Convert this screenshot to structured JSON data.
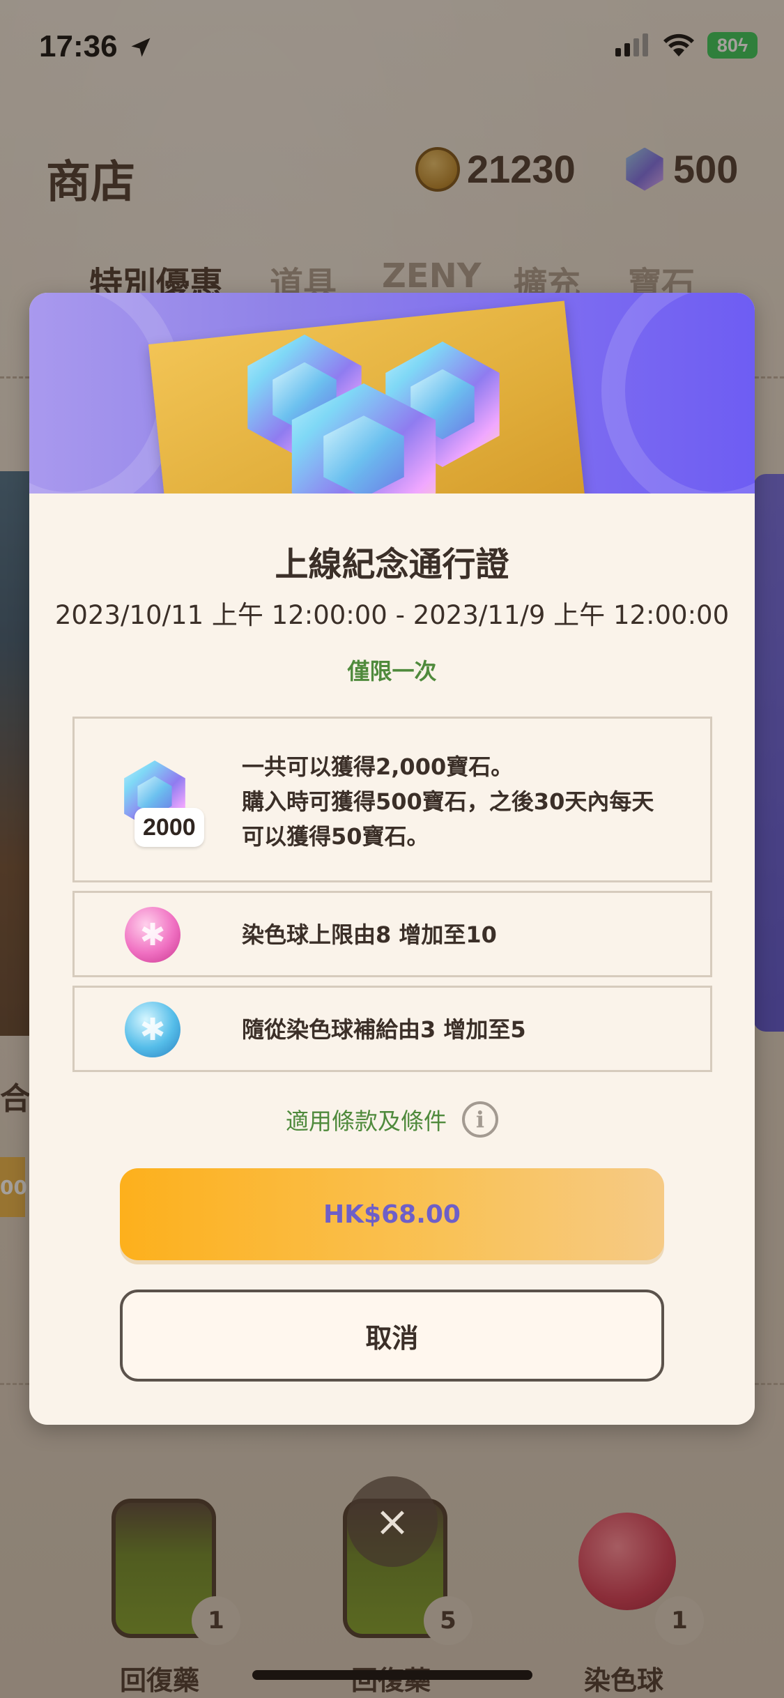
{
  "status_bar": {
    "time": "17:36",
    "battery": "80"
  },
  "shop": {
    "title": "商店",
    "coins": "21230",
    "gems": "500",
    "tabs": [
      "特別優惠",
      "道具",
      "ZENY",
      "擴充",
      "寶石"
    ],
    "active_tab": "特別優惠"
  },
  "background": {
    "bottom_items": [
      {
        "label": "回復藥",
        "count": "1"
      },
      {
        "label": "回復藥",
        "count": "5"
      },
      {
        "label": "染色球",
        "count": "1"
      }
    ],
    "close_symbol": "×"
  },
  "modal": {
    "title": "上線紀念通行證",
    "period": "2023/10/11 上午 12:00:00 - 2023/11/9 上午 12:00:00",
    "limit": "僅限一次",
    "rewards": [
      {
        "icon": "gem-icon",
        "badge": "2000",
        "lines": [
          "一共可以獲得2,000寶石。",
          "購入時可獲得500寶石，之後30天內每天",
          "可以獲得50寶石。"
        ]
      },
      {
        "icon": "pink-dye-ball-icon",
        "text": "染色球上限由8 增加至10"
      },
      {
        "icon": "blue-dye-ball-icon",
        "text": "隨從染色球補給由3 增加至5"
      }
    ],
    "terms": "適用條款及條件",
    "price": "HK$68.00",
    "cancel": "取消"
  }
}
